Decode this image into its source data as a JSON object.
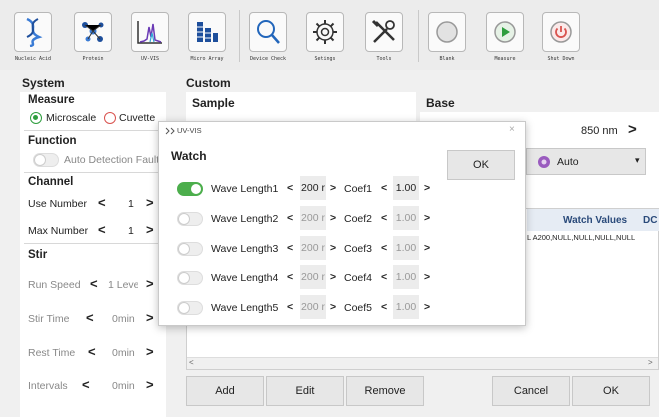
{
  "toolbar": {
    "items": [
      {
        "label": "Nucleic Acid",
        "icon": "dna-icon"
      },
      {
        "label": "Protein",
        "icon": "protein-icon"
      },
      {
        "label": "UV-VIS",
        "icon": "spectrum-icon"
      },
      {
        "label": "Micro Array",
        "icon": "micro-array-icon"
      },
      {
        "label": "Device Check",
        "icon": "magnifier-icon"
      },
      {
        "label": "Setings",
        "icon": "gear-icon"
      },
      {
        "label": "Tools",
        "icon": "tools-icon"
      },
      {
        "label": "Blank",
        "icon": "blank-icon"
      },
      {
        "label": "Measure",
        "icon": "play-icon"
      },
      {
        "label": "Shut Down",
        "icon": "power-icon"
      }
    ]
  },
  "left": {
    "system_title": "System",
    "measure_title": "Measure",
    "microscale_label": "Microscale",
    "cuvette_label": "Cuvette",
    "function_title": "Function",
    "auto_detection_label": "Auto Detection Fault",
    "channel_title": "Channel",
    "use_number_label": "Use Number",
    "use_number_value": "1",
    "max_number_label": "Max Number",
    "max_number_value": "1",
    "stir_title": "Stir",
    "run_speed_label": "Run Speed",
    "run_speed_value": "1 Leve",
    "stir_time_label": "Stir Time",
    "stir_time_value": "0min",
    "rest_time_label": "Rest Time",
    "rest_time_value": "0min",
    "intervals_label": "Intervals",
    "intervals_value": "0min"
  },
  "main": {
    "custom_title": "Custom",
    "sample_title": "Sample",
    "base_title": "Base",
    "base_wavelength": "850 nm",
    "auto_label": "Auto",
    "watch_values_header": "Watch Values",
    "dc_header": "DC I",
    "watch_values_cell": "A200,NULL,NULL,NULL,NULL",
    "row_prefix": "L",
    "add_label": "Add",
    "edit_label": "Edit",
    "remove_label": "Remove",
    "cancel_label": "Cancel",
    "ok_label": "OK"
  },
  "dialog": {
    "title": "UV-VIS",
    "watch_title": "Watch",
    "ok_label": "OK",
    "rows": [
      {
        "wave_label": "Wave Length1",
        "wave_value": "200 r",
        "coef_label": "Coef1",
        "coef_value": "1.00",
        "enabled": true
      },
      {
        "wave_label": "Wave Length2",
        "wave_value": "200 r",
        "coef_label": "Coef2",
        "coef_value": "1.00",
        "enabled": false
      },
      {
        "wave_label": "Wave Length3",
        "wave_value": "200 r",
        "coef_label": "Coef3",
        "coef_value": "1.00",
        "enabled": false
      },
      {
        "wave_label": "Wave Length4",
        "wave_value": "200 r",
        "coef_label": "Coef4",
        "coef_value": "1.00",
        "enabled": false
      },
      {
        "wave_label": "Wave Length5",
        "wave_value": "200 r",
        "coef_label": "Coef5",
        "coef_value": "1.00",
        "enabled": false
      }
    ]
  },
  "colors": {
    "toggle_on": "#4cae4c",
    "radio_on": "#2e9e3e",
    "radio_off": "#d9534f"
  }
}
